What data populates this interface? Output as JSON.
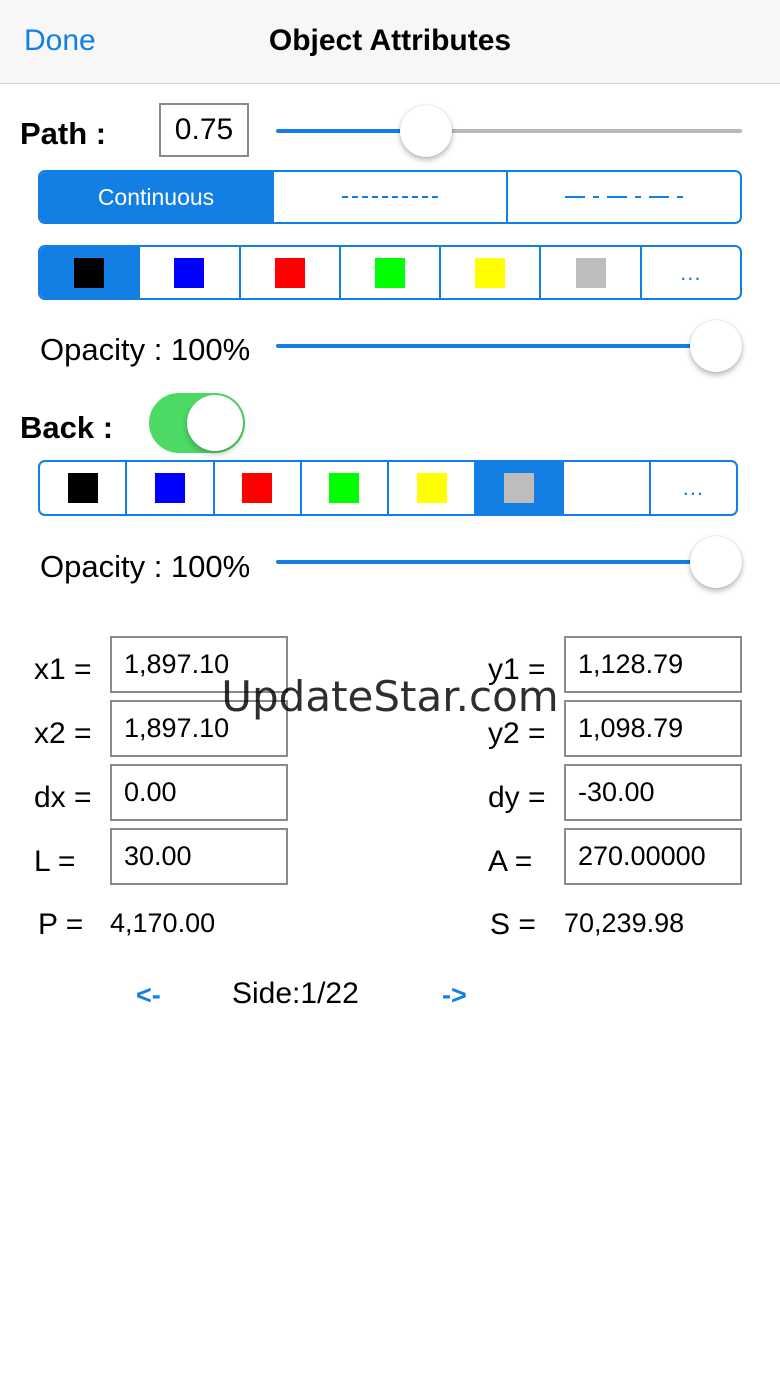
{
  "nav": {
    "done_label": "Done",
    "title": "Object Attributes"
  },
  "path": {
    "label": "Path :",
    "width_value": "0.75",
    "width_slider_fraction": 0.3,
    "line_styles": [
      {
        "label": "Continuous",
        "selected": true
      },
      {
        "label": "- - - - - -",
        "selected": false
      },
      {
        "label": "— - — - —",
        "selected": false
      }
    ],
    "colors": [
      "#000000",
      "#0000ff",
      "#ff0000",
      "#00ff00",
      "#ffff00",
      "#bdbdbd"
    ],
    "selected_color_index": 0,
    "more_label": "...",
    "opacity_label": "Opacity : 100%",
    "opacity_fraction": 1.0
  },
  "back": {
    "label": "Back :",
    "enabled": true,
    "colors": [
      "#000000",
      "#0000ff",
      "#ff0000",
      "#00ff00",
      "#ffff00",
      "#bdbdbd",
      "none"
    ],
    "selected_color_index": 5,
    "more_label": "...",
    "opacity_label": "Opacity : 100%",
    "opacity_fraction": 1.0
  },
  "coords": {
    "x1_label": "x1 =",
    "x1": "1,897.10",
    "y1_label": "y1 =",
    "y1": "1,128.79",
    "x2_label": "x2 =",
    "x2": "1,897.10",
    "y2_label": "y2 =",
    "y2": "1,098.79",
    "dx_label": "dx =",
    "dx": "0.00",
    "dy_label": "dy =",
    "dy": "-30.00",
    "l_label": "L =",
    "l": "30.00",
    "a_label": "A =",
    "a": "270.00000",
    "p_label": "P =",
    "p": "4,170.00",
    "s_label": "S =",
    "s": "70,239.98"
  },
  "side_nav": {
    "prev_label": "<-",
    "side_label": "Side:1/22",
    "next_label": "->"
  },
  "watermark": "UpdateStar.com",
  "colors": {
    "accent": "#137ee3",
    "toggle_on": "#4cd964"
  }
}
